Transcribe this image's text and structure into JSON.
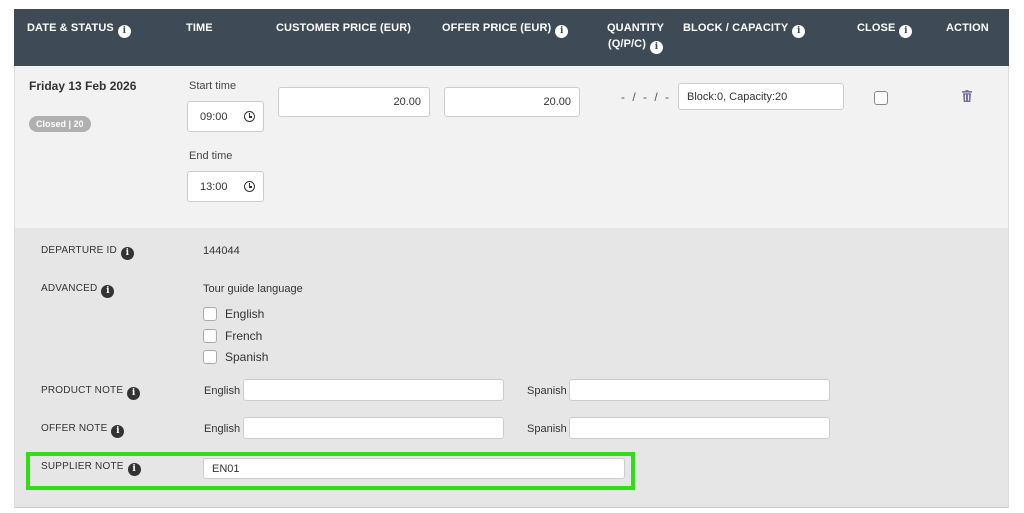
{
  "header": {
    "date_status": "DATE & STATUS",
    "time": "TIME",
    "customer_price": "CUSTOMER PRICE (EUR)",
    "offer_price": "OFFER PRICE (EUR)",
    "quantity_line1": "QUANTITY",
    "quantity_line2": "(Q/P/C)",
    "block_capacity": "BLOCK / CAPACITY",
    "close": "CLOSE",
    "action": "ACTION",
    "info_glyph": "i"
  },
  "row": {
    "date": "Friday 13 Feb 2026",
    "status_badge": "Closed | 20",
    "start_time_label": "Start time",
    "start_time": "09:00",
    "end_time_label": "End time",
    "end_time": "13:00",
    "customer_price": "20.00",
    "offer_price": "20.00",
    "quantity": "- / - / -",
    "block_capacity": "Block:0, Capacity:20"
  },
  "advanced": {
    "departure_id_label": "DEPARTURE ID",
    "departure_id": "144044",
    "advanced_label": "ADVANCED",
    "tour_guide_language_label": "Tour guide language",
    "languages": [
      "English",
      "French",
      "Spanish"
    ],
    "product_note_label": "PRODUCT NOTE",
    "offer_note_label": "OFFER NOTE",
    "english_label": "English",
    "spanish_label": "Spanish",
    "supplier_note_label": "SUPPLIER NOTE",
    "supplier_note_value": "EN01"
  },
  "colors": {
    "header_bg": "#3e4a56",
    "highlight": "#2ee00f",
    "trash": "#7a6fa8"
  },
  "icons": [
    "info-icon",
    "clock-icon",
    "trash-icon"
  ]
}
